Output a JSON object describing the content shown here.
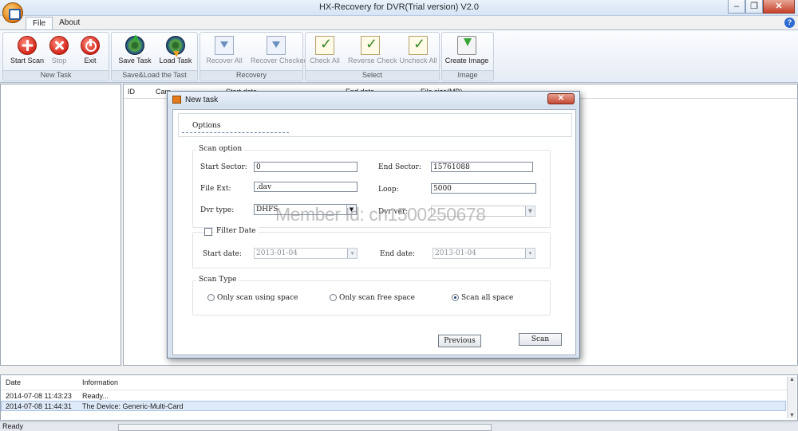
{
  "window": {
    "title": "HX-Recovery for DVR(Trial version) V2.0",
    "minimize": "–",
    "restore": "❐",
    "close": "✕"
  },
  "tabs": [
    "File",
    "About"
  ],
  "help": "?",
  "ribbon": {
    "groups": [
      {
        "label": "New Task",
        "buttons": [
          "Start Scan",
          "Stop",
          "Exit"
        ]
      },
      {
        "label": "Save&Load the Tast",
        "buttons": [
          "Save Task",
          "Load Task"
        ]
      },
      {
        "label": "Recovery",
        "buttons": [
          "Recover All",
          "Recover Checked"
        ]
      },
      {
        "label": "Select",
        "buttons": [
          "Check All",
          "Reverse Check",
          "Uncheck All"
        ]
      },
      {
        "label": "Image",
        "buttons": [
          "Create Image"
        ]
      }
    ]
  },
  "grid": {
    "columns": [
      "ID",
      "Cam",
      "Start date",
      "End date",
      "File size(MB)"
    ]
  },
  "dialog": {
    "title": "New task",
    "close": "✕",
    "tab": "Options",
    "scan_option": {
      "legend": "Scan option",
      "start_sector_label": "Start Sector:",
      "start_sector": "0",
      "end_sector_label": "End Sector:",
      "end_sector": "15761088",
      "file_ext_label": "File Ext:",
      "file_ext": ".dav",
      "loop_label": "Loop:",
      "loop": "5000",
      "dvr_type_label": "Dvr type:",
      "dvr_type": "DHFS",
      "dvr_ver_label": "Dvr ver:",
      "dvr_ver": ""
    },
    "filter_date": {
      "legend": "Filter Date",
      "start_label": "Start date:",
      "start": "2013-01-04",
      "end_label": "End date:",
      "end": "2013-01-04"
    },
    "scan_type": {
      "legend": "Scan Type",
      "options": [
        "Only scan using space",
        "Only scan free space",
        "Scan all space"
      ],
      "selected": "Scan all space"
    },
    "buttons": {
      "previous": "Previous",
      "scan": "Scan"
    }
  },
  "watermark": "Member Id: cn1500250678",
  "log": {
    "columns": [
      "Date",
      "Information"
    ],
    "rows": [
      {
        "date": "2014-07-08 11:43:23",
        "info": "Ready..."
      },
      {
        "date": "2014-07-08 11:44:31",
        "info": "The Device: Generic-Multi-Card"
      }
    ]
  },
  "status": "Ready"
}
